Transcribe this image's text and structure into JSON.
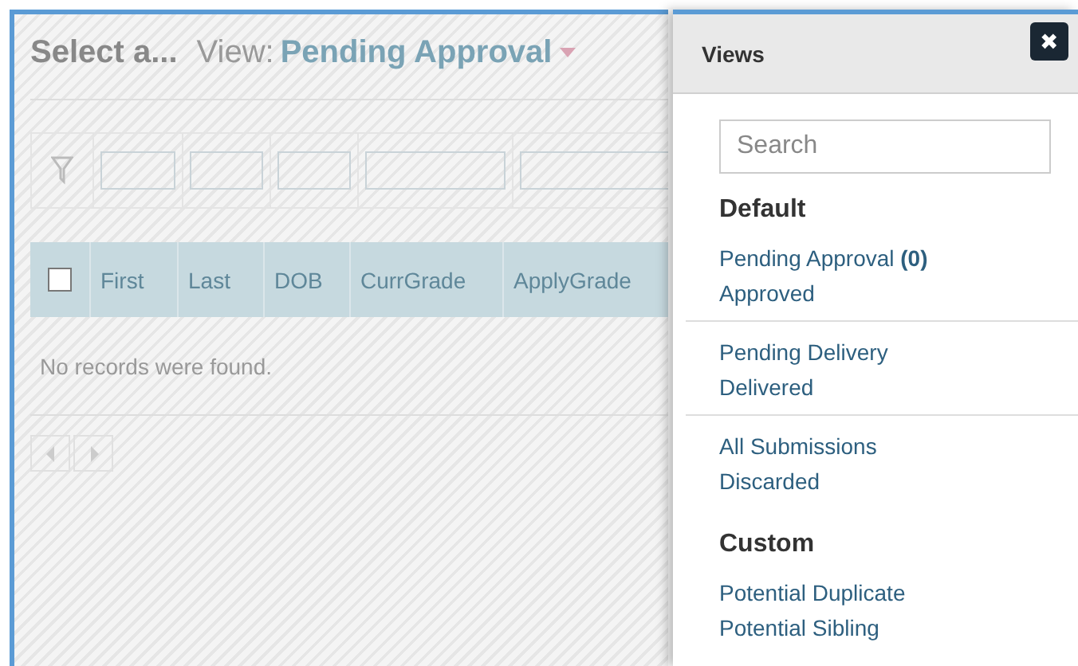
{
  "header": {
    "title": "Select a...",
    "view_label": "View:",
    "view_name": "Pending Approval"
  },
  "table": {
    "select_all_checked": false,
    "columns": [
      "First",
      "Last",
      "DOB",
      "CurrGrade",
      "ApplyGrade"
    ],
    "empty_message": "No records were found."
  },
  "views_panel": {
    "title": "Views",
    "close_icon": "✖",
    "search": {
      "placeholder": "Search"
    },
    "sections": [
      {
        "heading": "Default",
        "groups": [
          [
            "Pending Approval **(0)**",
            "Approved"
          ],
          [
            "Pending Delivery",
            "Delivered"
          ],
          [
            "All Submissions",
            "Discarded"
          ]
        ]
      },
      {
        "heading": "Custom",
        "groups": [
          [
            "Potential Duplicate",
            "Potential Sibling"
          ]
        ]
      }
    ]
  }
}
